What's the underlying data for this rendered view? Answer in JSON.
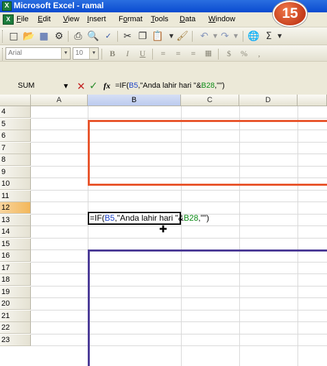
{
  "window": {
    "app_icon": "excel-icon",
    "title": "Microsoft Excel - ramal"
  },
  "step_badge": "15",
  "menu": {
    "items": [
      {
        "label": "File",
        "key": "F",
        "rest": "ile"
      },
      {
        "label": "Edit",
        "key": "E",
        "rest": "dit"
      },
      {
        "label": "View",
        "key": "V",
        "rest": "iew"
      },
      {
        "label": "Insert",
        "key": "I",
        "rest": "nsert"
      },
      {
        "label": "Format",
        "key": "o",
        "pre": "F",
        "rest": "rmat"
      },
      {
        "label": "Tools",
        "key": "T",
        "rest": "ools"
      },
      {
        "label": "Data",
        "key": "D",
        "rest": "ata"
      },
      {
        "label": "Window",
        "key": "W",
        "rest": "indow"
      }
    ]
  },
  "toolbar": {
    "buttons": [
      "new-icon",
      "open-icon",
      "save-icon",
      "permission-icon",
      "print-icon",
      "print-preview-icon",
      "spelling-icon",
      "cut-icon",
      "copy-icon",
      "paste-icon",
      "format-painter-icon",
      "undo-icon",
      "redo-icon",
      "hyperlink-icon",
      "autosum-icon"
    ]
  },
  "format_toolbar": {
    "font": "Arial",
    "size": "10",
    "bold": "B",
    "italic": "I",
    "underline": "U",
    "currency": "$",
    "percent": "%",
    "comma": ","
  },
  "formula_bar": {
    "name_box": "SUM",
    "cancel": "✕",
    "enter": "✓",
    "fx": "fx",
    "formula_prefix": "=IF(",
    "formula_ref1": "B5",
    "formula_mid": ",\"Anda lahir hari \"&",
    "formula_ref2": "B28",
    "formula_suffix": ",\"\")"
  },
  "sheet": {
    "columns": [
      "A",
      "B",
      "C",
      "D"
    ],
    "selected_column": "B",
    "rows": [
      "4",
      "5",
      "6",
      "7",
      "8",
      "9",
      "10",
      "11",
      "12",
      "13",
      "14",
      "15",
      "16",
      "17",
      "18",
      "19",
      "20",
      "21",
      "22",
      "23"
    ],
    "selected_row": "12",
    "active_cell": "B12"
  },
  "colors": {
    "title_bar": "#0a4bd0",
    "ref_blue": "#1d43c9",
    "ref_green": "#0a8a14",
    "highlight_orange": "#e8542b",
    "highlight_purple": "#4a3a96"
  }
}
